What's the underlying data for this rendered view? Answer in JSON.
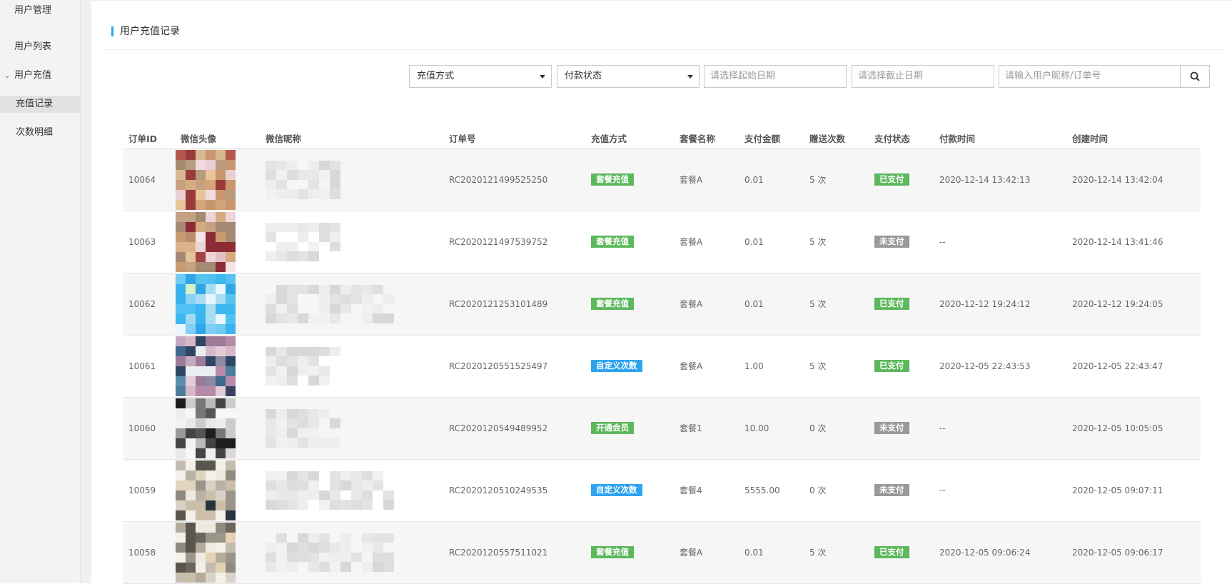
{
  "sidebar": {
    "section_user_mgmt": "用户管理",
    "user_list": "用户列表",
    "user_recharge": "用户充值",
    "recharge_records": "充值记录",
    "times_detail": "次数明细"
  },
  "page": {
    "title": "用户充值记录"
  },
  "filters": {
    "recharge_method": "充值方式",
    "payment_status": "付款状态",
    "start_date_placeholder": "请选择起始日期",
    "end_date_placeholder": "请选择截止日期",
    "search_placeholder": "请输入用户昵称/订单号"
  },
  "table": {
    "headers": [
      "订单ID",
      "微信头像",
      "微信昵称",
      "订单号",
      "充值方式",
      "套餐名称",
      "支付金额",
      "赠送次数",
      "支付状态",
      "付款时间",
      "创建时间"
    ],
    "rows": [
      {
        "id": "10064",
        "order_no": "RC2020121499525250",
        "method": "套餐充值",
        "package": "套餐A",
        "amount": "0.01",
        "gift": "5 次",
        "status": "已支付",
        "paid_at": "2020-12-14 13:42:13",
        "created_at": "2020-12-14 13:42:04"
      },
      {
        "id": "10063",
        "order_no": "RC2020121497539752",
        "method": "套餐充值",
        "package": "套餐A",
        "amount": "0.01",
        "gift": "5 次",
        "status": "未支付",
        "paid_at": "--",
        "created_at": "2020-12-14 13:41:46"
      },
      {
        "id": "10062",
        "order_no": "RC2020121253101489",
        "method": "套餐充值",
        "package": "套餐A",
        "amount": "0.01",
        "gift": "5 次",
        "status": "已支付",
        "paid_at": "2020-12-12 19:24:12",
        "created_at": "2020-12-12 19:24:05"
      },
      {
        "id": "10061",
        "order_no": "RC2020120551525497",
        "method": "自定义次数",
        "package": "套餐A",
        "amount": "1.00",
        "gift": "5 次",
        "status": "已支付",
        "paid_at": "2020-12-05 22:43:53",
        "created_at": "2020-12-05 22:43:47"
      },
      {
        "id": "10060",
        "order_no": "RC2020120549489952",
        "method": "开通会员",
        "package": "套餐1",
        "amount": "10.00",
        "gift": "0 次",
        "status": "未支付",
        "paid_at": "--",
        "created_at": "2020-12-05 10:05:05"
      },
      {
        "id": "10059",
        "order_no": "RC2020120510249535",
        "method": "自定义次数",
        "package": "套餐4",
        "amount": "5555.00",
        "gift": "0 次",
        "status": "未支付",
        "paid_at": "--",
        "created_at": "2020-12-05 09:07:11"
      },
      {
        "id": "10058",
        "order_no": "RC2020120557511021",
        "method": "套餐充值",
        "package": "套餐A",
        "amount": "0.01",
        "gift": "5 次",
        "status": "已支付",
        "paid_at": "2020-12-05 09:06:24",
        "created_at": "2020-12-05 09:06:17"
      }
    ]
  },
  "colors": {
    "method_package": "#5cb85c",
    "method_custom": "#2ea3ee",
    "method_member": "#5cb85c",
    "status_paid": "#5cb85c",
    "status_unpaid": "#999999",
    "accent": "#2ea3ee"
  },
  "icons": {
    "search": "search-icon",
    "chevron": "chevron-down-icon",
    "caret": "caret-down-icon"
  }
}
